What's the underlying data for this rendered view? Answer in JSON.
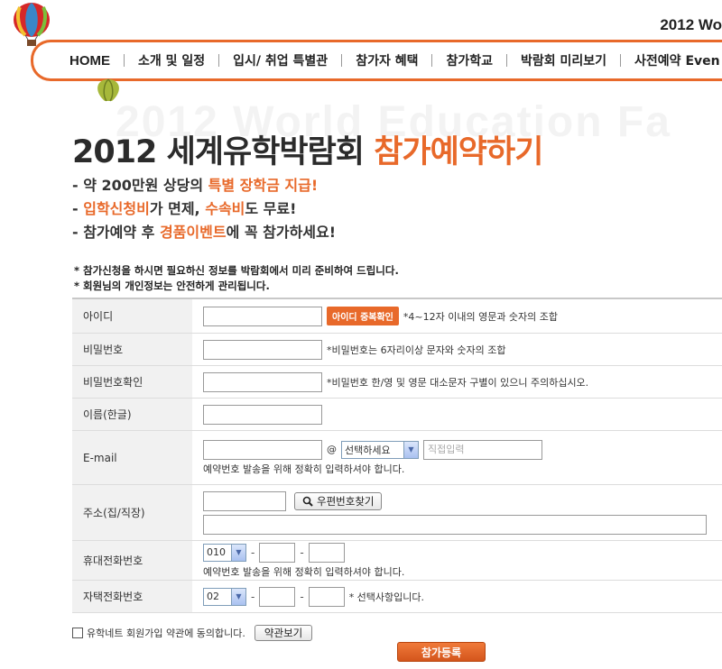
{
  "header": {
    "top_title": "2012 Wo",
    "nav": [
      "HOME",
      "소개 및 일정",
      "입시/ 취업 특별관",
      "참가자 혜택",
      "참가학교",
      "박람회 미리보기",
      "사전예약 Even"
    ]
  },
  "hero": {
    "watermark": "2012 World Education Fa",
    "title_main": "2012 세계유학박람회 ",
    "title_accent": "참가예약하기",
    "bullets": [
      {
        "pre": "- 약 200만원 상당의 ",
        "hl": "특별 장학금 지급!",
        "post": ""
      },
      {
        "pre": "- ",
        "hl": "입학신청비",
        "post": "가 면제, ",
        "hl2": "수속비",
        "post2": "도 무료!"
      },
      {
        "pre": "- 참가예약 후 ",
        "hl": "경품이벤트",
        "post": "에 꼭 참가하세요!"
      }
    ]
  },
  "notes": [
    "* 참가신청을 하시면 필요하신 정보를 박람회에서 미리 준비하여 드립니다.",
    "* 회원님의 개인정보는 안전하게 관리됩니다."
  ],
  "form": {
    "id_label": "아이디",
    "id_check_button": "아이디 중복확인",
    "id_hint": "*4~12자 이내의 영문과 숫자의 조합",
    "pw_label": "비밀번호",
    "pw_hint": "*비밀번호는 6자리이상 문자와 숫자의 조합",
    "pw_confirm_label": "비밀번호확인",
    "pw_confirm_hint": "*비밀번호 한/영 및 영문 대소문자 구별이 있으니 주의하십시오.",
    "name_label": "이름(한글)",
    "email_label": "E-mail",
    "email_at": "@",
    "email_select": "선택하세요",
    "email_direct_placeholder": "직접입력",
    "email_hint": "예약번호 발송을 위해 정확히 입력하셔야 합니다.",
    "address_label": "주소(집/직장)",
    "zip_button": "우편번호찾기",
    "mobile_label": "휴대전화번호",
    "mobile_prefix": "010",
    "mobile_hint": "예약번호 발송을 위해 정확히 입력하셔야 합니다.",
    "home_label": "자택전화번호",
    "home_prefix": "02",
    "home_hint": "* 선택사항입니다.",
    "dash": "-"
  },
  "agree": {
    "text": "유학네트 회원가입 약관에 동의합니다.",
    "terms_button": "약관보기"
  },
  "submit_label": "참가등록",
  "colors": {
    "accent": "#e8692a"
  }
}
